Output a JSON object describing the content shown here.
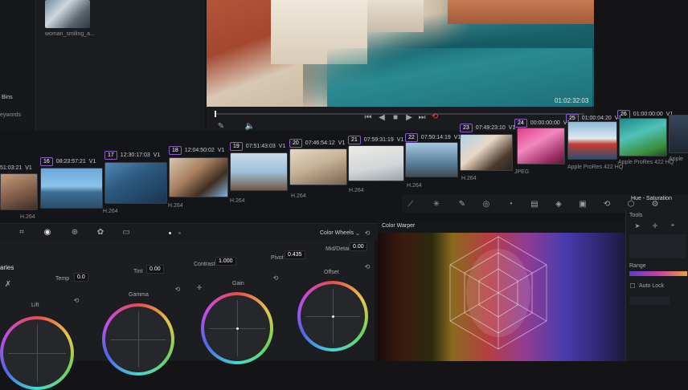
{
  "media_pool": {
    "bins": [
      "Bins",
      "eywords"
    ],
    "thumbnail": {
      "name": "woman_smiling_a..."
    }
  },
  "viewer": {
    "timecode": "01:02:32:03"
  },
  "clips": [
    {
      "tc": "51:03:21",
      "num": "",
      "track": "V1",
      "codec": "H.264"
    },
    {
      "tc": "08:23:57:21",
      "num": "16",
      "track": "V1",
      "codec": ""
    },
    {
      "tc": "12:30:17:03",
      "num": "17",
      "track": "V1",
      "codec": "H.264"
    },
    {
      "tc": "12:04:50:02",
      "num": "18",
      "track": "V1",
      "codec": "H.264"
    },
    {
      "tc": "07:51:43:03",
      "num": "19",
      "track": "V1",
      "codec": "H.264"
    },
    {
      "tc": "07:46:54:12",
      "num": "20",
      "track": "V1",
      "codec": "H.264"
    },
    {
      "tc": "07:59:31:19",
      "num": "21",
      "track": "V1",
      "codec": "H.264"
    },
    {
      "tc": "07:50:14:19",
      "num": "22",
      "track": "V1",
      "codec": "H.264"
    },
    {
      "tc": "07:49:23:10",
      "num": "23",
      "track": "V1",
      "codec": "H.264"
    },
    {
      "tc": "00:00:00:00",
      "num": "24",
      "track": "V1",
      "codec": "JPEG"
    },
    {
      "tc": "01:00:04:20",
      "num": "25",
      "track": "V1",
      "codec": "Apple ProRes 422 HQ"
    },
    {
      "tc": "01:00:00:00",
      "num": "26",
      "track": "V1",
      "codec": "Apple ProRes 422 HQ"
    },
    {
      "tc": "",
      "num": "",
      "track": "",
      "codec": "Apple"
    }
  ],
  "color_wheels": {
    "mode": "Color Wheels",
    "section": "aries",
    "temp": {
      "label": "Temp",
      "value": "0.0"
    },
    "tint": {
      "label": "Tint",
      "value": "0.00"
    },
    "contrast": {
      "label": "Contrast",
      "value": "1.000"
    },
    "pivot": {
      "label": "Pivot",
      "value": "0.435"
    },
    "middetail": {
      "label": "Mid/Detail",
      "value": "0.00"
    },
    "wheels": [
      "Lift",
      "Gamma",
      "Gain",
      "Offset"
    ]
  },
  "warper": {
    "title": "Color Warper"
  },
  "hue_sat": {
    "title": "Hue - Saturation",
    "tools_label": "Tools",
    "range_label": "Range",
    "auto_lock": "Auto Lock"
  },
  "colors": {
    "accent_purple": "#8a5cc7",
    "record_red": "#e34b4b"
  }
}
